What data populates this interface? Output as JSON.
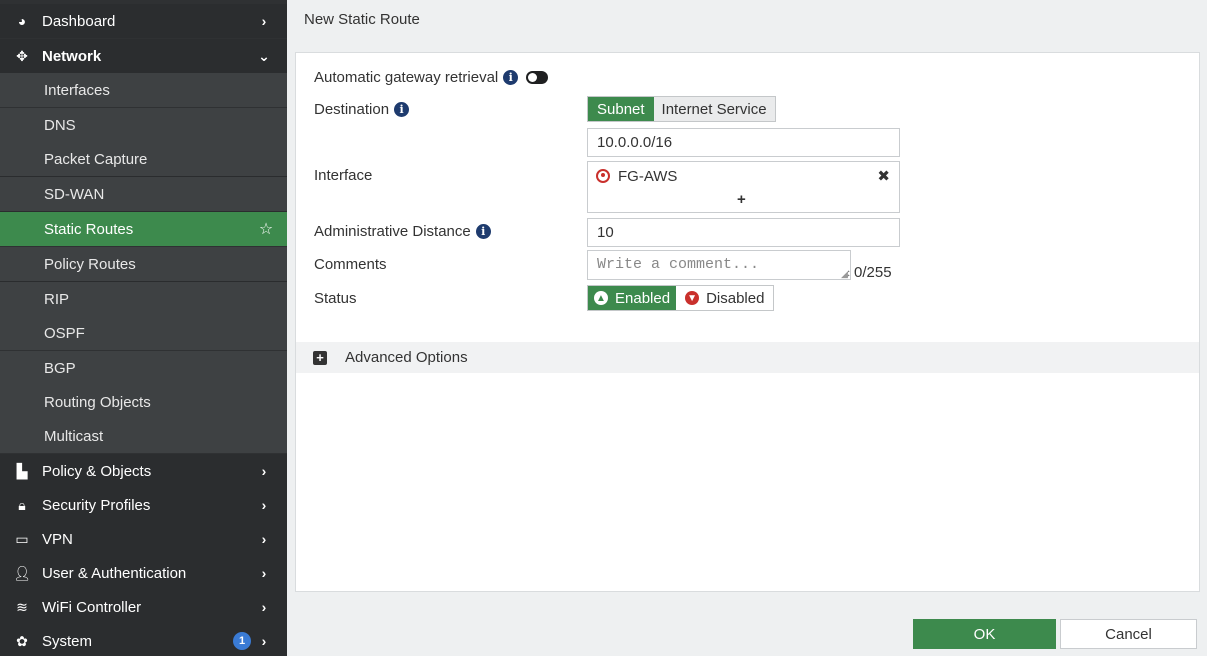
{
  "sidebar": {
    "dashboard": "Dashboard",
    "network": "Network",
    "interfaces": "Interfaces",
    "dns": "DNS",
    "packet_capture": "Packet Capture",
    "sdwan": "SD-WAN",
    "static_routes": "Static Routes",
    "policy_routes": "Policy Routes",
    "rip": "RIP",
    "ospf": "OSPF",
    "bgp": "BGP",
    "routing_objects": "Routing Objects",
    "multicast": "Multicast",
    "policy_objects": "Policy & Objects",
    "security_profiles": "Security Profiles",
    "vpn": "VPN",
    "user_auth": "User & Authentication",
    "wifi": "WiFi Controller",
    "system": "System",
    "system_badge": "1"
  },
  "header": {
    "title": "New Static Route"
  },
  "form": {
    "auto_gateway_label": "Automatic gateway retrieval",
    "destination_label": "Destination",
    "destination_options": [
      "Subnet",
      "Internet Service"
    ],
    "destination_value": "10.0.0.0/16",
    "interface_label": "Interface",
    "interface_value": "FG-AWS",
    "interface_add": "+",
    "admin_distance_label": "Administrative Distance",
    "admin_distance_value": "10",
    "comments_label": "Comments",
    "comments_placeholder": "Write a comment...",
    "comments_count": "0/255",
    "status_label": "Status",
    "status_enabled": "Enabled",
    "status_disabled": "Disabled",
    "advanced_options": "Advanced Options"
  },
  "footer": {
    "ok": "OK",
    "cancel": "Cancel"
  }
}
